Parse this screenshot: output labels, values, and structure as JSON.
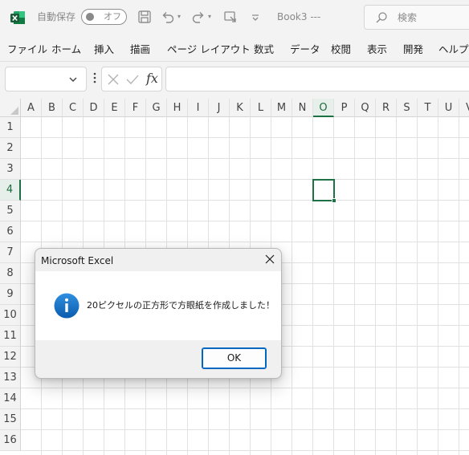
{
  "titlebar": {
    "autosave_label": "自動保存",
    "autosave_toggle": "オフ",
    "doc_title": "Book3 ‐‐‐",
    "search_placeholder": "検索"
  },
  "ribbon": {
    "tabs": [
      "ファイル",
      "ホーム",
      "挿入",
      "描画",
      "ページ レイアウト",
      "数式",
      "データ",
      "校閲",
      "表示",
      "開発",
      "ヘルプ"
    ]
  },
  "formula_bar": {
    "name_box": "",
    "fx_label": "fx",
    "formula": ""
  },
  "sheet": {
    "columns": [
      "A",
      "B",
      "C",
      "D",
      "E",
      "F",
      "G",
      "H",
      "I",
      "J",
      "K",
      "L",
      "M",
      "N",
      "O",
      "P",
      "Q",
      "R",
      "S",
      "T",
      "U",
      "V"
    ],
    "rows": [
      "1",
      "2",
      "3",
      "4",
      "5",
      "6",
      "7",
      "8",
      "9",
      "10",
      "11",
      "12",
      "13",
      "14",
      "15",
      "16"
    ],
    "active_column": "O",
    "active_row": "4"
  },
  "dialog": {
    "title": "Microsoft Excel",
    "message": "20ピクセルの正方形で方眼紙を作成しました！",
    "ok_label": "OK"
  },
  "colors": {
    "excel_green": "#1e7145",
    "info_blue": "#0067c0"
  }
}
